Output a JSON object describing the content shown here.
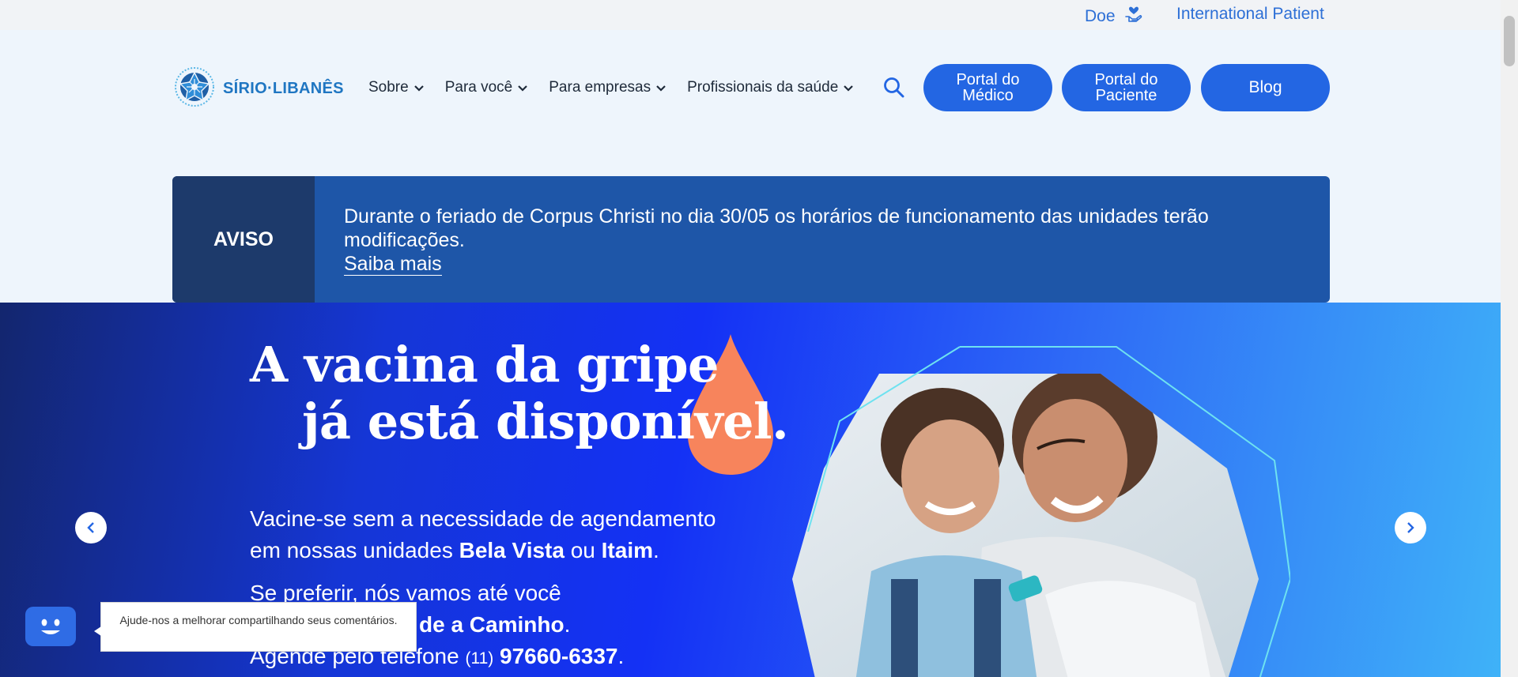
{
  "topbar": {
    "doe_label": "Doe",
    "international_label": "International Patient"
  },
  "header": {
    "logo_text": "SÍRIO·LIBANÊS",
    "nav": [
      {
        "label": "Sobre"
      },
      {
        "label": "Para você"
      },
      {
        "label": "Para empresas"
      },
      {
        "label": "Profissionais da saúde"
      }
    ],
    "portal_medico": "Portal do Médico",
    "portal_paciente": "Portal do Paciente",
    "blog": "Blog"
  },
  "notice": {
    "label": "AVISO",
    "text": "Durante o feriado de Corpus Christi no dia 30/05 os horários de funcionamento das unidades terão modificações.",
    "link": "Saiba mais"
  },
  "hero": {
    "title_line1": "A vacina da gripe",
    "title_line2": "já está disponível.",
    "p1_a": "Vacine-se sem a necessidade de agendamento",
    "p1_b": "em nossas unidades ",
    "p1_bold1": "Bela Vista",
    "p1_c": " ou ",
    "p1_bold2": "Itaim",
    "p1_d": ".",
    "p2_a": "Se preferir, nós vamos até você",
    "p2_bold": "de a Caminho",
    "p2_b": ".",
    "p2_c": "Agende pelo telefone ",
    "p2_prefix": "(11)",
    "p2_phone": "97660-6337",
    "p2_d": "."
  },
  "feedback": {
    "tooltip": "Ajude-nos a melhorar compartilhando seus comentários."
  },
  "colors": {
    "primary": "#2366e3",
    "notice_bg": "#1e56a8",
    "notice_label_bg": "#1d3a6b",
    "drop": "#f7845c"
  }
}
